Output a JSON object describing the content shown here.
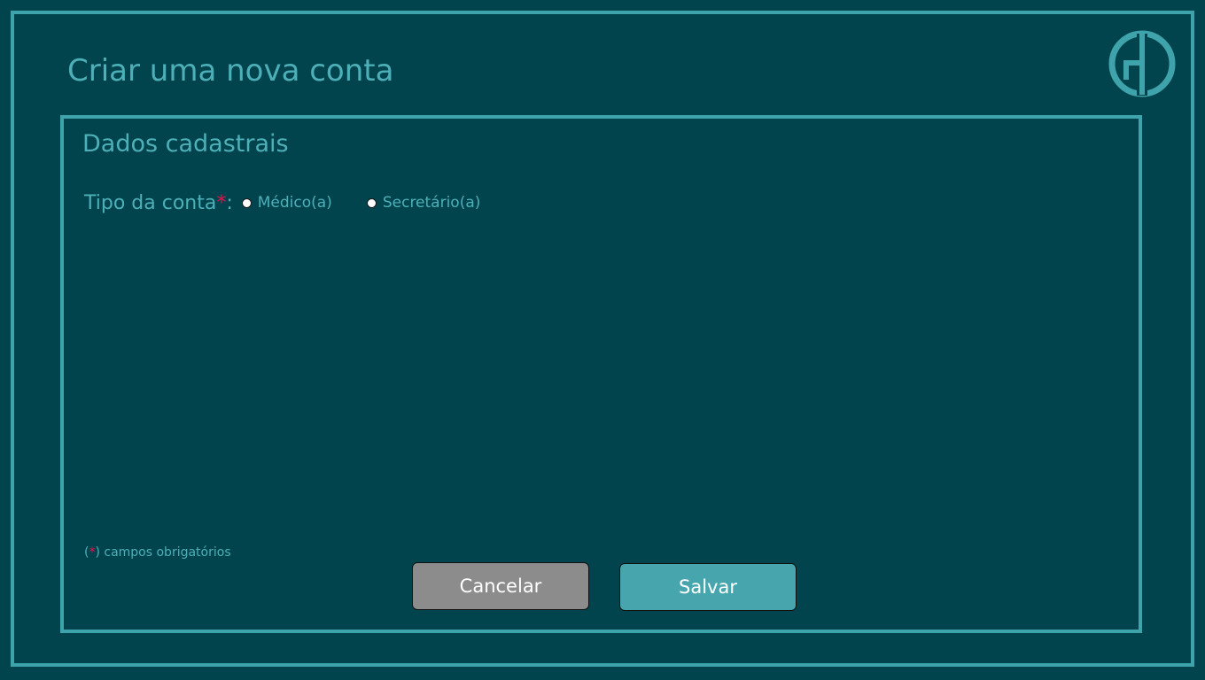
{
  "page": {
    "title": "Criar uma nova conta",
    "logo_icon": "gi-monogram-logo"
  },
  "panel": {
    "title": "Dados cadastrais"
  },
  "account_type": {
    "label": "Tipo da conta",
    "required_mark": "*",
    "colon": ":",
    "options": [
      {
        "label": "Médico(a)",
        "selected": false
      },
      {
        "label": "Secretário(a)",
        "selected": false
      }
    ]
  },
  "required_note": {
    "open": "(",
    "star": "*",
    "text": ") campos obrigatórios"
  },
  "buttons": {
    "cancel": "Cancelar",
    "save": "Salvar"
  },
  "colors": {
    "background": "#02444d",
    "accent": "#4db0b8",
    "border": "#3fa3ac",
    "required": "#e8104a",
    "cancel_button": "#8c8c8c",
    "save_button": "#47a5ae"
  }
}
